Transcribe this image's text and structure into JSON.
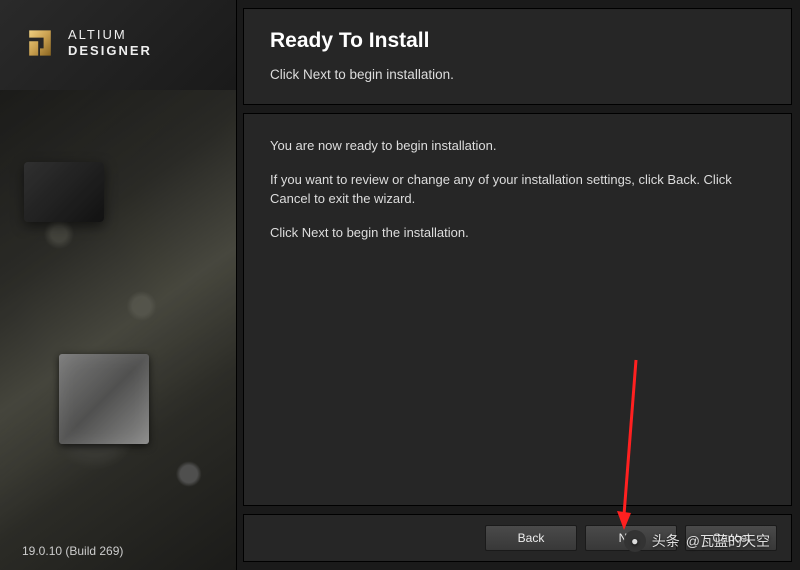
{
  "brand": {
    "line1": "ALTIUM",
    "line2": "DESIGNER"
  },
  "version": "19.0.10 (Build 269)",
  "header": {
    "title": "Ready To Install",
    "subtitle": "Click Next to begin installation."
  },
  "body": {
    "p1": "You are now ready to begin installation.",
    "p2": "If you want to review or change any of your installation settings, click Back. Click Cancel to exit the wizard.",
    "p3": "Click Next to begin the installation."
  },
  "buttons": {
    "back": "Back",
    "next": "Next",
    "cancel": "Cancel"
  },
  "watermark": {
    "prefix": "头条",
    "text": "@瓦蓝的天空"
  }
}
